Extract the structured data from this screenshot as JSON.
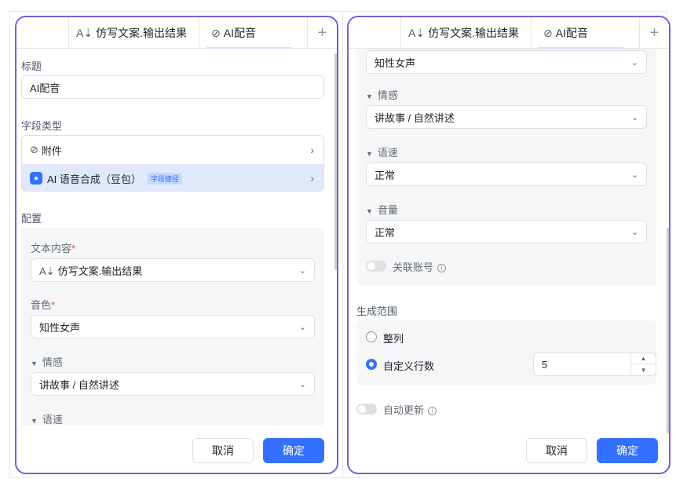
{
  "tabs": {
    "tab1": "仿写文案.输出结果",
    "tab2": "AI配音",
    "add": "+"
  },
  "left": {
    "title_label": "标题",
    "title_value": "AI配音",
    "field_type_label": "字段类型",
    "field_type_options": [
      {
        "label": "附件",
        "icon": "attachment-plus-icon"
      },
      {
        "label": "AI 语音合成（豆包）",
        "tag": "字段捷径",
        "icon": "ai-voice-icon"
      }
    ],
    "config_label": "配置",
    "text_content_label": "文本内容",
    "text_content_value": "仿写文案.输出结果",
    "voice_label": "音色",
    "voice_value": "知性女声",
    "emotion_label": "情感",
    "emotion_value": "讲故事 / 自然讲述",
    "speed_label": "语速",
    "required_mark": "*",
    "cancel": "取消",
    "ok": "确定"
  },
  "right": {
    "voice_value": "知性女声",
    "emotion_label": "情感",
    "emotion_value": "讲故事 / 自然讲述",
    "speed_label": "语速",
    "speed_value": "正常",
    "volume_label": "音量",
    "volume_value": "正常",
    "link_account_label": "关联账号",
    "range_label": "生成范围",
    "range_whole": "整列",
    "range_custom": "自定义行数",
    "rows_value": "5",
    "auto_update_label": "自动更新",
    "cancel": "取消",
    "ok": "确定"
  },
  "icons": {
    "info": "ⓘ",
    "chevron_down": "⌄",
    "chevron_right": "›",
    "triangle": "▼",
    "up": "⌃",
    "down": "⌄"
  },
  "colors": {
    "accent": "#3370ff",
    "frame": "#7b5bd6",
    "selected_row": "#e1e8fb",
    "required": "#f54a45"
  }
}
